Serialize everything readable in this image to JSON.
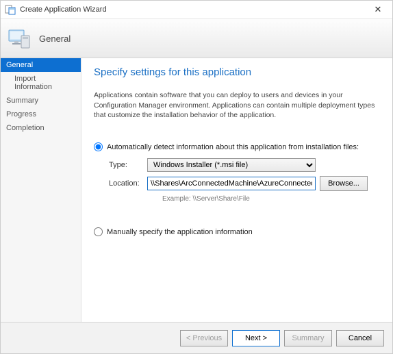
{
  "titlebar": {
    "title": "Create Application Wizard"
  },
  "header": {
    "text": "General"
  },
  "sidebar": {
    "items": [
      {
        "label": "General",
        "active": true
      },
      {
        "label": "Import Information",
        "sub": true
      },
      {
        "label": "Summary"
      },
      {
        "label": "Progress"
      },
      {
        "label": "Completion"
      }
    ]
  },
  "main": {
    "page_title": "Specify settings for this application",
    "description": "Applications contain software that you can deploy to users and devices in your Configuration Manager environment. Applications can contain multiple deployment types that customize the installation behavior of the application.",
    "option_auto": "Automatically detect information about this application from installation files:",
    "option_manual": "Manually specify the application information",
    "type_label": "Type:",
    "type_value": "Windows Installer (*.msi file)",
    "location_label": "Location:",
    "location_value": "\\\\Shares\\ArcConnectedMachine\\AzureConnectedMachineAgent.msi",
    "browse": "Browse...",
    "example": "Example: \\\\Server\\Share\\File"
  },
  "footer": {
    "previous": "< Previous",
    "next": "Next >",
    "summary": "Summary",
    "cancel": "Cancel"
  }
}
